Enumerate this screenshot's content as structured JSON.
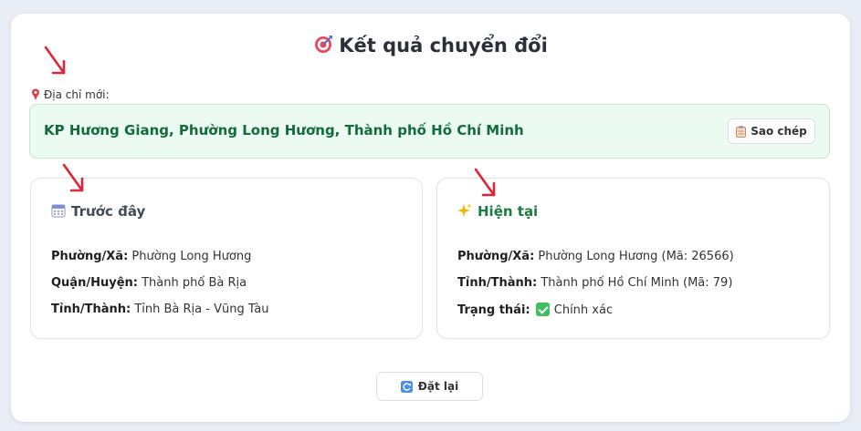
{
  "header": {
    "title": "Kết quả chuyển đổi",
    "icon": "target-icon"
  },
  "new_address": {
    "label": "Địa chỉ mới:",
    "value": "KP Hương Giang, Phường Long Hương, Thành phố Hồ Chí Minh",
    "copy_label": "Sao chép"
  },
  "before": {
    "title": "Trước đây",
    "ward_label": "Phường/Xã:",
    "ward": "Phường Long Hương",
    "district_label": "Quận/Huyện:",
    "district": "Thành phố Bà Rịa",
    "province_label": "Tỉnh/Thành:",
    "province": "Tỉnh Bà Rịa - Vũng Tàu"
  },
  "current": {
    "title": "Hiện tại",
    "ward_label": "Phường/Xã:",
    "ward": "Phường Long Hương  (Mã: 26566)",
    "province_label": "Tỉnh/Thành:",
    "province": "Thành phố Hồ Chí Minh  (Mã: 79)",
    "status_label": "Trạng thái:",
    "status": "Chính xác"
  },
  "reset_label": "Đặt lại",
  "colors": {
    "accent_green": "#126b3a",
    "result_bg": "#ecfbf1",
    "arrow_red": "#e0243a"
  }
}
